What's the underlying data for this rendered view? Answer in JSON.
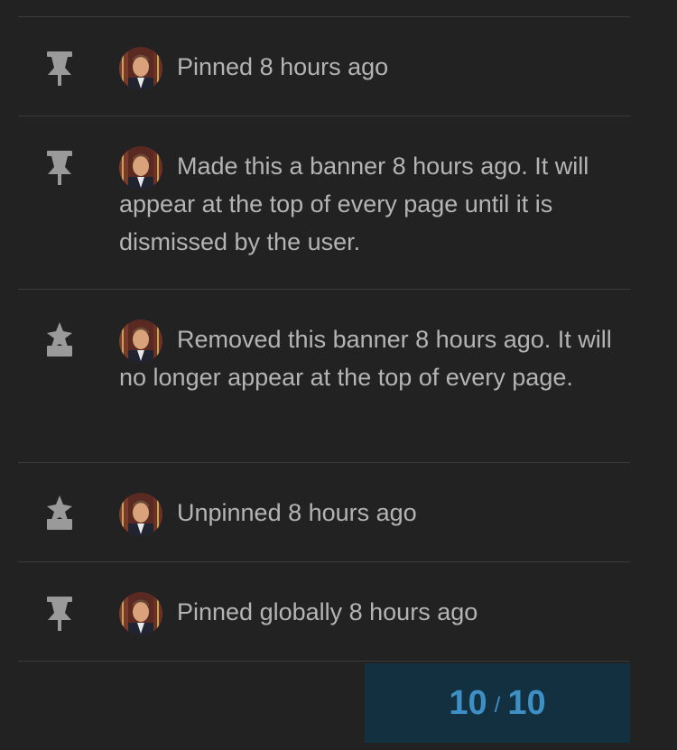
{
  "events": [
    {
      "icon": "pin-icon",
      "text": "Pinned 8 hours ago"
    },
    {
      "icon": "pin-icon",
      "text": "Made this a banner 8 hours ago. It will appear at the top of every page until it is dismissed by the user."
    },
    {
      "icon": "unpin-icon",
      "text": "Removed this banner 8 hours ago. It will no longer appear at the top of every page."
    },
    {
      "icon": "unpin-icon",
      "text": "Unpinned 8 hours ago"
    },
    {
      "icon": "pin-icon",
      "text": "Pinned globally 8 hours ago"
    }
  ],
  "pager": {
    "current": "10",
    "separator": "/",
    "total": "10"
  },
  "colors": {
    "background": "#222222",
    "text": "#b4b4b4",
    "icon": "#9a9a9a",
    "divider": "#3a3a3a",
    "pager_bg": "#12303f",
    "pager_text": "#3d8fc6"
  }
}
